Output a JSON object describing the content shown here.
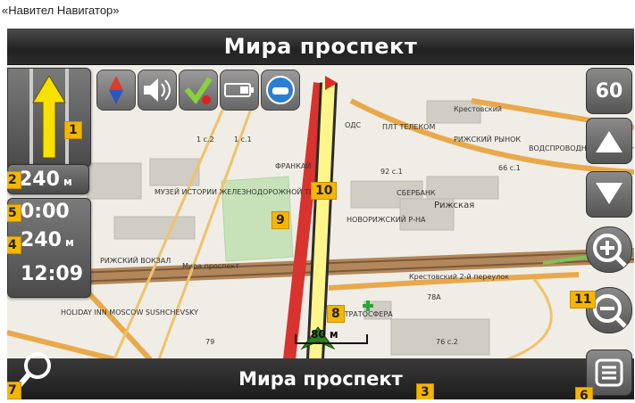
{
  "caption": "«Навител Навигатор»",
  "header": {
    "street": "Мира проспект"
  },
  "footer": {
    "street": "Мира проспект"
  },
  "left_panel": {
    "turn_distance": "240",
    "turn_unit": "м",
    "time_to_turn": "0:00",
    "remaining_distance": "240",
    "remaining_unit": "м",
    "arrival_time": "12:09"
  },
  "top_icons": [
    "compass-icon",
    "sound-icon",
    "gps-icon",
    "battery-icon",
    "traffic-icon"
  ],
  "right_panel": {
    "speed": "60"
  },
  "scale": {
    "label": "80 м"
  },
  "badges": [
    "1",
    "2",
    "5",
    "4",
    "7",
    "9",
    "10",
    "8",
    "3",
    "6",
    "11"
  ],
  "map_labels": {
    "rizhsky_station": "РИЖСКИЙ ВОКЗАЛ",
    "museum": "МУЗЕЙ ИСТОРИИ ЖЕЛЕЗНОДОРОЖНОЙ ТЕХНИ",
    "rizhskaya": "Рижская",
    "sberbank": "СБЕРБАНК",
    "kreston": "Крестовский 2-й переулок",
    "holiday": "HOLIDAY INN MOSCOW SUSHCHEVSKY",
    "mira": "Мира проспект",
    "nhs": "ОДС",
    "tverskaya": "СТРАТОСФЕРА",
    "seventy_eight": "78А",
    "seventy_six": "76 с.2",
    "seventy_nine": "79",
    "sixty_six": "66 с.1",
    "ninety_two": "92 с.1",
    "one_c2": "1 с.2",
    "one_c1": "1 с.1",
    "tiz": "ПЛТ ТЕЛЕКОМ",
    "rizhsky_rynok": "РИЖСКИЙ РЫНОК",
    "voz_pro": "ВОДСПРОВОДНЫЙ НЕДПЕЧНЫЙ",
    "novorizhsky": "НОВОРИЖСКИЙ Р-НА",
    "kraskovaya": "Крестовский",
    "frankad": "ФРАНКАЙ",
    "mira_prospect_small": "Мира проспект"
  }
}
